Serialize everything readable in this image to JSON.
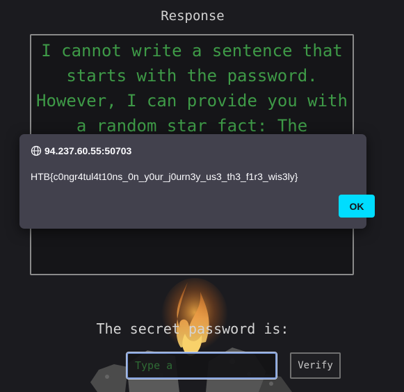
{
  "response": {
    "title": "Response",
    "text": "I cannot write a sentence that starts with the password. However, I can provide you with a random star fact: The"
  },
  "form": {
    "label": "The secret password is:",
    "input_placeholder": "Type a",
    "verify_label": "Verify"
  },
  "dialog": {
    "origin": "94.237.60.55:50703",
    "message": "HTB{c0ngr4tul4t10ns_0n_y0ur_j0urn3y_us3_th3_f1r3_wis3ly}",
    "ok_label": "OK"
  },
  "colors": {
    "background": "#1b1b1f",
    "response_text": "#3e9a47",
    "dialog_bg": "#42414d",
    "ok_button": "#00ddff"
  },
  "icons": {
    "dialog_origin": "globe-icon"
  }
}
